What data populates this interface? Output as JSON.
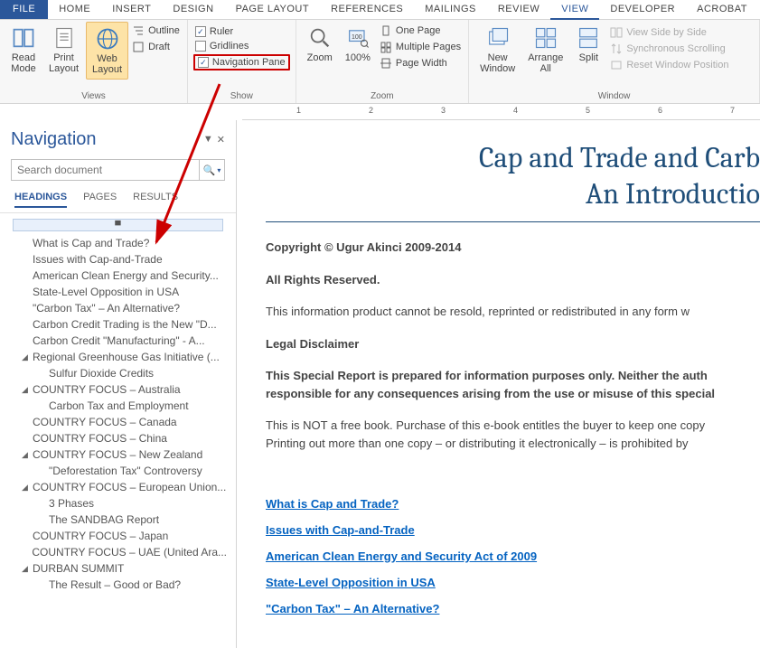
{
  "menubar": {
    "file": "FILE",
    "tabs": [
      "HOME",
      "INSERT",
      "DESIGN",
      "PAGE LAYOUT",
      "REFERENCES",
      "MAILINGS",
      "REVIEW",
      "VIEW",
      "DEVELOPER",
      "ACROBAT"
    ],
    "active": "VIEW"
  },
  "ribbon": {
    "views": {
      "read_mode": "Read\nMode",
      "print_layout": "Print\nLayout",
      "web_layout": "Web\nLayout",
      "outline": "Outline",
      "draft": "Draft",
      "group": "Views"
    },
    "show": {
      "ruler": "Ruler",
      "gridlines": "Gridlines",
      "navigation_pane": "Navigation Pane",
      "group": "Show"
    },
    "zoom": {
      "zoom": "Zoom",
      "hundred": "100%",
      "one_page": "One Page",
      "multiple_pages": "Multiple Pages",
      "page_width": "Page Width",
      "group": "Zoom"
    },
    "window": {
      "new_window": "New\nWindow",
      "arrange_all": "Arrange\nAll",
      "split": "Split",
      "view_side": "View Side by Side",
      "sync_scroll": "Synchronous Scrolling",
      "reset_pos": "Reset Window Position",
      "group": "Window"
    }
  },
  "ruler_marks": [
    "1",
    "2",
    "3",
    "4",
    "5",
    "6",
    "7"
  ],
  "navpane": {
    "title": "Navigation",
    "search_placeholder": "Search document",
    "search_glyph": "🔍",
    "dropdown_glyph": "▾",
    "pin_glyph": "▼",
    "close_glyph": "✕",
    "tabs": {
      "headings": "HEADINGS",
      "pages": "PAGES",
      "results": "RESULTS"
    },
    "jump_glyph": "▀",
    "items": [
      {
        "level": 1,
        "caret": "",
        "text": "What is Cap and Trade?"
      },
      {
        "level": 1,
        "caret": "",
        "text": "Issues with Cap-and-Trade"
      },
      {
        "level": 1,
        "caret": "",
        "text": "American Clean Energy and Security..."
      },
      {
        "level": 1,
        "caret": "",
        "text": "State-Level Opposition in USA"
      },
      {
        "level": 1,
        "caret": "",
        "text": "\"Carbon Tax\" – An Alternative?"
      },
      {
        "level": 1,
        "caret": "",
        "text": "Carbon Credit Trading is the New \"D..."
      },
      {
        "level": 1,
        "caret": "",
        "text": "Carbon Credit \"Manufacturing\" - A..."
      },
      {
        "level": 1,
        "caret": "◢",
        "text": "Regional Greenhouse Gas Initiative (..."
      },
      {
        "level": 2,
        "caret": "",
        "text": "Sulfur Dioxide Credits"
      },
      {
        "level": 1,
        "caret": "◢",
        "text": "COUNTRY FOCUS – Australia"
      },
      {
        "level": 2,
        "caret": "",
        "text": "Carbon Tax and Employment"
      },
      {
        "level": 1,
        "caret": "",
        "text": "COUNTRY FOCUS – Canada"
      },
      {
        "level": 1,
        "caret": "",
        "text": "COUNTRY FOCUS – China"
      },
      {
        "level": 1,
        "caret": "◢",
        "text": "COUNTRY FOCUS – New Zealand"
      },
      {
        "level": 2,
        "caret": "",
        "text": "\"Deforestation Tax\" Controversy"
      },
      {
        "level": 1,
        "caret": "◢",
        "text": "COUNTRY FOCUS – European Union..."
      },
      {
        "level": 2,
        "caret": "",
        "text": "3 Phases"
      },
      {
        "level": 2,
        "caret": "",
        "text": "The SANDBAG Report"
      },
      {
        "level": 1,
        "caret": "",
        "text": "COUNTRY FOCUS – Japan"
      },
      {
        "level": 1,
        "caret": "",
        "text": "COUNTRY FOCUS – UAE (United Ara..."
      },
      {
        "level": 1,
        "caret": "◢",
        "text": "DURBAN SUMMIT"
      },
      {
        "level": 2,
        "caret": "",
        "text": "The Result – Good or Bad?"
      }
    ]
  },
  "doc": {
    "title_line1": "Cap and Trade and Carb",
    "title_line2": "An Introductio",
    "copyright": "Copyright © Ugur Akinci 2009-2014",
    "rights": "All Rights Reserved.",
    "para1": "This information product cannot be resold, reprinted or redistributed in any form w",
    "legal": "Legal Disclaimer",
    "para2": "This Special Report is prepared for information purposes only. Neither the auth responsible for any consequences arising from the use or misuse of this special ",
    "para3a": "This is NOT a free book. Purchase of this e-book entitles the buyer to keep one copy",
    "para3b": "Printing out more than one copy – or distributing it electronically – is prohibited by",
    "toc": [
      "What is Cap and Trade?",
      "Issues with Cap-and-Trade",
      "American Clean Energy and Security Act of 2009",
      "State-Level Opposition in USA",
      "\"Carbon Tax\" – An Alternative?"
    ]
  }
}
